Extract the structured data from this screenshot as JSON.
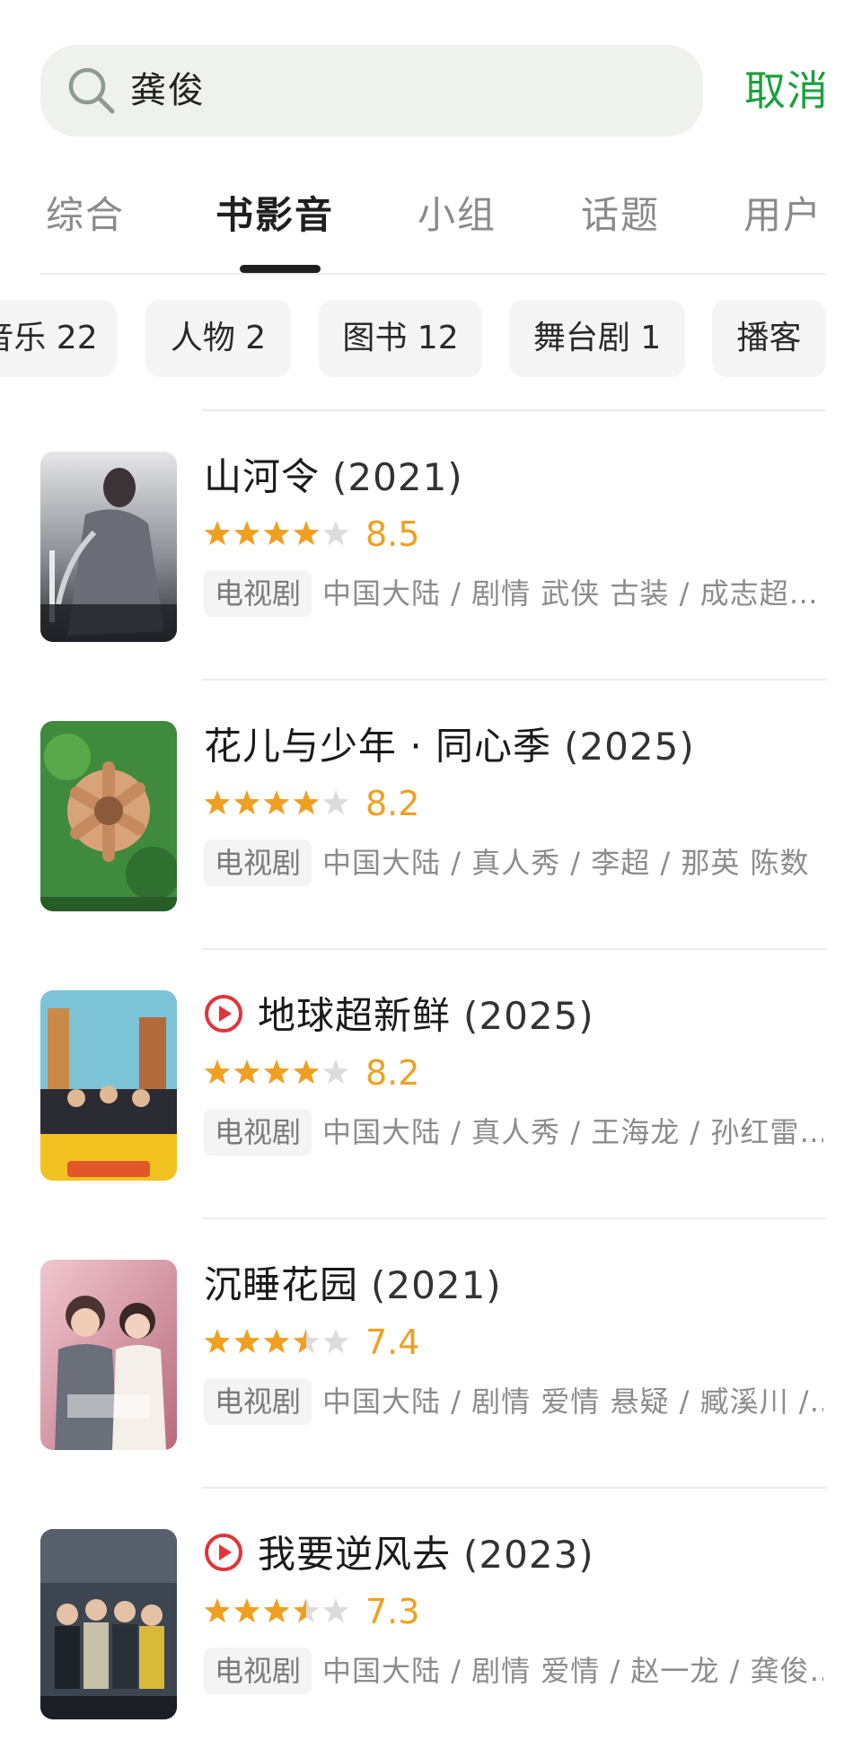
{
  "search": {
    "query": "龚俊",
    "cancel_label": "取消"
  },
  "tabs": [
    {
      "label": "综合"
    },
    {
      "label": "书影音",
      "active": true
    },
    {
      "label": "小组"
    },
    {
      "label": "话题"
    },
    {
      "label": "用户"
    }
  ],
  "chips": [
    {
      "label": "音乐 22"
    },
    {
      "label": "人物 2"
    },
    {
      "label": "图书 12"
    },
    {
      "label": "舞台剧 1"
    },
    {
      "label": "播客"
    }
  ],
  "results": [
    {
      "title": "山河令",
      "year": "(2021)",
      "playable": false,
      "rating_stars": 4,
      "score": "8.5",
      "type": "电视剧",
      "meta": "中国大陆 / 剧情 武侠 古装 / 成志超…",
      "poster_icon": "poster-image"
    },
    {
      "title": "花儿与少年 · 同心季",
      "year": "(2025)",
      "playable": false,
      "rating_stars": 4,
      "score": "8.2",
      "type": "电视剧",
      "meta": "中国大陆 / 真人秀 / 李超 / 那英 陈数",
      "poster_icon": "poster-image"
    },
    {
      "title": "地球超新鲜",
      "year": "(2025)",
      "playable": true,
      "rating_stars": 4,
      "score": "8.2",
      "type": "电视剧",
      "meta": "中国大陆 / 真人秀 / 王海龙 / 孙红雷…",
      "poster_icon": "poster-image"
    },
    {
      "title": "沉睡花园",
      "year": "(2021)",
      "playable": false,
      "rating_stars": 3.5,
      "score": "7.4",
      "type": "电视剧",
      "meta": "中国大陆 / 剧情 爱情 悬疑 / 臧溪川 /…",
      "poster_icon": "poster-image"
    },
    {
      "title": "我要逆风去",
      "year": "(2023)",
      "playable": true,
      "rating_stars": 3.5,
      "score": "7.3",
      "type": "电视剧",
      "meta": "中国大陆 / 剧情 爱情 / 赵一龙 / 龚俊…",
      "poster_icon": "poster-image"
    }
  ],
  "colors": {
    "accent_green": "#1aa03d",
    "star_orange": "#f0a020",
    "play_red": "#e0343b",
    "star_empty": "#dcdcdc"
  }
}
